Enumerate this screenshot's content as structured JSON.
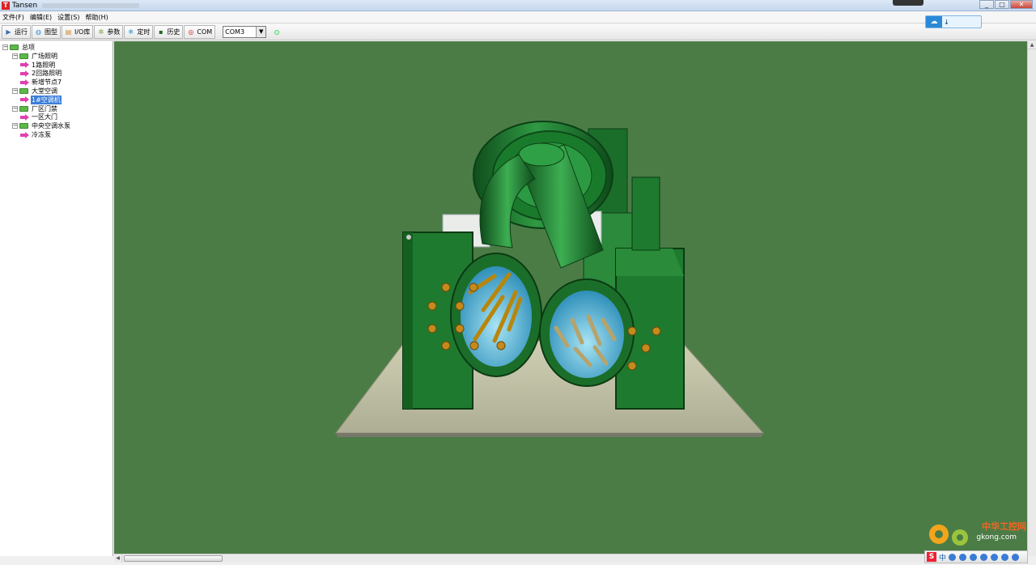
{
  "window": {
    "title": "Tansen"
  },
  "menu": [
    "文件(F)",
    "编辑(E)",
    "设置(S)",
    "帮助(H)"
  ],
  "toolbar": {
    "buttons": [
      {
        "label": "运行",
        "icon": "run-icon",
        "color": "#3a6fb0"
      },
      {
        "label": "图型",
        "icon": "globe-icon",
        "color": "#2f8fd8"
      },
      {
        "label": "I/O库",
        "icon": "book-icon",
        "color": "#c98b2e"
      },
      {
        "label": "参数",
        "icon": "gear-icon",
        "color": "#6a9a3a"
      },
      {
        "label": "定时",
        "icon": "snowflake-icon",
        "color": "#2b8fd1"
      },
      {
        "label": "历史",
        "icon": "history-icon",
        "color": "#226622"
      },
      {
        "label": "COM",
        "icon": "com-icon",
        "color": "#cc2222"
      }
    ],
    "port": "COM3"
  },
  "cloud_widget": {
    "value": "↓"
  },
  "tree": [
    {
      "label": "总项",
      "level": 0,
      "type": "folder"
    },
    {
      "label": "广场照明",
      "level": 1,
      "type": "folder"
    },
    {
      "label": "1路照明",
      "level": 2,
      "type": "node"
    },
    {
      "label": "2回路照明",
      "level": 2,
      "type": "node"
    },
    {
      "label": "新增节点7",
      "level": 2,
      "type": "node"
    },
    {
      "label": "大堂空调",
      "level": 1,
      "type": "folder"
    },
    {
      "label": "1#空调机",
      "level": 2,
      "type": "node",
      "selected": true
    },
    {
      "label": "厂区门禁",
      "level": 1,
      "type": "folder"
    },
    {
      "label": "一区大门",
      "level": 2,
      "type": "node"
    },
    {
      "label": "中央空调水泵",
      "level": 1,
      "type": "folder"
    },
    {
      "label": "冷冻泵",
      "level": 2,
      "type": "node"
    }
  ],
  "ime": {
    "lang": "中"
  },
  "watermark": {
    "site": "中华工控网",
    "url": "gkong.com"
  },
  "colors": {
    "canvas": "#4c7c46",
    "machine": "#1f7a2e",
    "arrow": "#e040b0",
    "selection": "#3c7fd9"
  }
}
